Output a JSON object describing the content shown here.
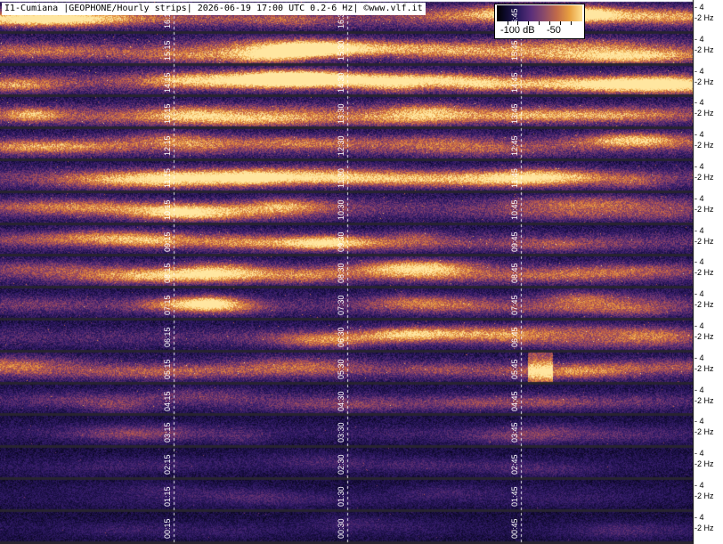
{
  "header": {
    "title": "I1-Cumiana |GEOPHONE/Hourly strips| 2026-06-19 17:00 UTC 0.2-6 Hz| ©www.vlf.it"
  },
  "colorbar": {
    "label_low": "-100 dB",
    "label_high": "-50",
    "colors": [
      "#000000",
      "#2a1a5e",
      "#8a4a6a",
      "#e8a040",
      "#ffe090"
    ]
  },
  "axis": {
    "tick_4": "4",
    "tick_2": "2 Hz"
  },
  "strips": [
    {
      "hour": "16",
      "labels": [
        "16:15",
        "16:30",
        "16:45"
      ],
      "brightness": 0.85,
      "burst_at": -1
    },
    {
      "hour": "15",
      "labels": [
        "15:15",
        "15:30",
        "15:45"
      ],
      "brightness": 0.9,
      "burst_at": -1
    },
    {
      "hour": "14",
      "labels": [
        "14:15",
        "14:30",
        "14:45"
      ],
      "brightness": 0.9,
      "burst_at": -1
    },
    {
      "hour": "13",
      "labels": [
        "13:15",
        "13:30",
        "13:45"
      ],
      "brightness": 0.85,
      "burst_at": -1
    },
    {
      "hour": "12",
      "labels": [
        "12:15",
        "12:30",
        "12:45"
      ],
      "brightness": 0.8,
      "burst_at": -1
    },
    {
      "hour": "11",
      "labels": [
        "11:15",
        "11:30",
        "11:45"
      ],
      "brightness": 0.75,
      "burst_at": -1
    },
    {
      "hour": "10",
      "labels": [
        "10:15",
        "10:30",
        "10:45"
      ],
      "brightness": 0.7,
      "burst_at": -1
    },
    {
      "hour": "09",
      "labels": [
        "09:15",
        "09:30",
        "09:45"
      ],
      "brightness": 0.7,
      "burst_at": -1
    },
    {
      "hour": "08",
      "labels": [
        "08:15",
        "08:30",
        "08:45"
      ],
      "brightness": 0.7,
      "burst_at": -1
    },
    {
      "hour": "07",
      "labels": [
        "07:15",
        "07:30",
        "07:45"
      ],
      "brightness": 0.65,
      "burst_at": -1
    },
    {
      "hour": "06",
      "labels": [
        "06:15",
        "06:30",
        "06:45"
      ],
      "brightness": 0.65,
      "burst_at": -1
    },
    {
      "hour": "05",
      "labels": [
        "05:15",
        "05:30",
        "05:45"
      ],
      "brightness": 0.7,
      "burst_at": 0.78
    },
    {
      "hour": "04",
      "labels": [
        "04:15",
        "04:30",
        "04:45"
      ],
      "brightness": 0.55,
      "burst_at": -1
    },
    {
      "hour": "03",
      "labels": [
        "03:15",
        "03:30",
        "03:45"
      ],
      "brightness": 0.4,
      "burst_at": -1
    },
    {
      "hour": "02",
      "labels": [
        "02:15",
        "02:30",
        "02:45"
      ],
      "brightness": 0.3,
      "burst_at": -1
    },
    {
      "hour": "01",
      "labels": [
        "01:15",
        "01:30",
        "01:45"
      ],
      "brightness": 0.25,
      "burst_at": -1
    },
    {
      "hour": "00",
      "labels": [
        "00:15",
        "00:30",
        "00:45"
      ],
      "brightness": 0.25,
      "burst_at": -1
    }
  ]
}
